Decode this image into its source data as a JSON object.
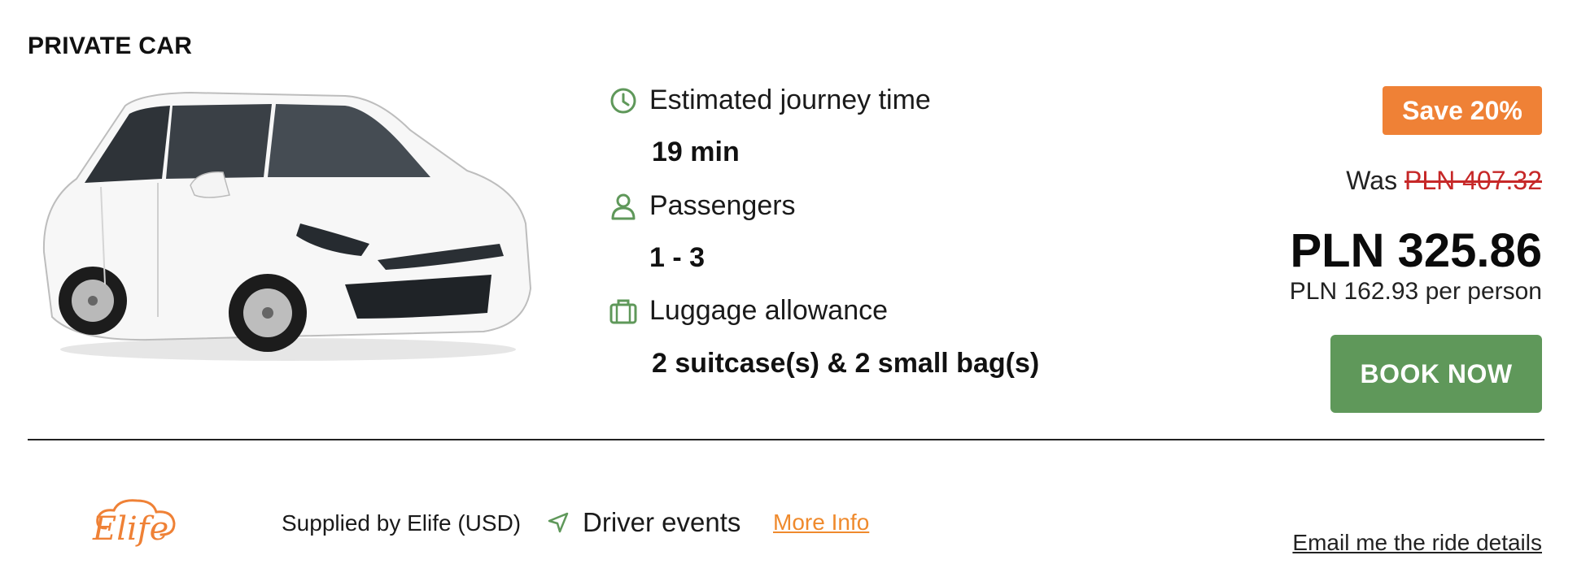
{
  "vehicle": {
    "title": "PRIVATE CAR",
    "image_icon": "white-minivan-car"
  },
  "details": {
    "journey": {
      "label": "Estimated journey time",
      "value": "19 min",
      "icon": "clock-icon"
    },
    "passengers": {
      "label": "Passengers",
      "value": "1 - 3",
      "icon": "person-icon"
    },
    "luggage": {
      "label": "Luggage allowance",
      "value": "2 suitcase(s) & 2 small bag(s)",
      "icon": "suitcase-icon"
    }
  },
  "pricing": {
    "badge": "Save 20%",
    "was_label": "Was",
    "was_price": "PLN 407.32",
    "price": "PLN 325.86",
    "per_person": "PLN 162.93 per person",
    "book_label": "BOOK NOW"
  },
  "footer": {
    "logo_text": "Elife",
    "supplied_by": "Supplied by Elife (USD)",
    "driver_events": "Driver events",
    "more_info": "More Info",
    "email_link": "Email me the ride details"
  },
  "colors": {
    "accent_green": "#5f985a",
    "badge_orange": "#ef8136",
    "link_orange": "#ef8a2d",
    "strike_red": "#c62828"
  }
}
